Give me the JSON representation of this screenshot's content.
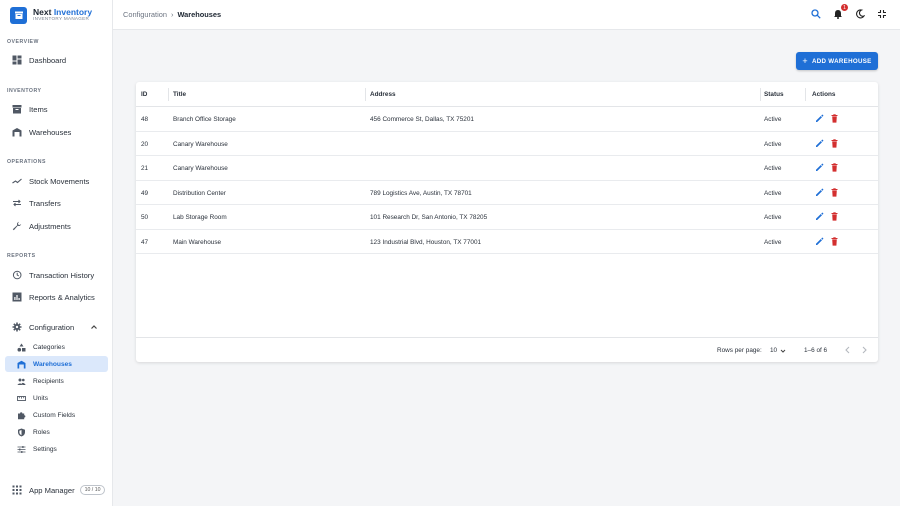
{
  "brand": {
    "name_part1": "Next",
    "name_part2": "Inventory",
    "subtitle": "INVENTORY MANAGER"
  },
  "sidebar": {
    "sections": {
      "overview": "OVERVIEW",
      "inventory": "INVENTORY",
      "operations": "OPERATIONS",
      "reports": "REPORTS"
    },
    "items": {
      "dashboard": "Dashboard",
      "items": "Items",
      "warehouses": "Warehouses",
      "stock_movements": "Stock Movements",
      "transfers": "Transfers",
      "adjustments": "Adjustments",
      "transaction_history": "Transaction History",
      "reports_analytics": "Reports & Analytics",
      "configuration": "Configuration"
    },
    "config_sub": {
      "categories": "Categories",
      "warehouses": "Warehouses",
      "recipients": "Recipients",
      "units": "Units",
      "custom_fields": "Custom Fields",
      "roles": "Roles",
      "settings": "Settings"
    },
    "app_manager": {
      "label": "App Manager",
      "badge": "10 / 10"
    }
  },
  "header": {
    "breadcrumb_parent": "Configuration",
    "breadcrumb_sep": "›",
    "breadcrumb_current": "Warehouses",
    "notification_count": "1"
  },
  "toolbar": {
    "add_label": "ADD WAREHOUSE",
    "add_icon": "+"
  },
  "table": {
    "columns": {
      "id": "ID",
      "title": "Title",
      "address": "Address",
      "status": "Status",
      "actions": "Actions"
    },
    "rows": [
      {
        "id": "48",
        "title": "Branch Office Storage",
        "address": "456 Commerce St, Dallas, TX 75201",
        "status": "Active"
      },
      {
        "id": "20",
        "title": "Canary Warehouse",
        "address": "",
        "status": "Active"
      },
      {
        "id": "21",
        "title": "Canary Warehouse",
        "address": "",
        "status": "Active"
      },
      {
        "id": "49",
        "title": "Distribution Center",
        "address": "789 Logistics Ave, Austin, TX 78701",
        "status": "Active"
      },
      {
        "id": "50",
        "title": "Lab Storage Room",
        "address": "101 Research Dr, San Antonio, TX 78205",
        "status": "Active"
      },
      {
        "id": "47",
        "title": "Main Warehouse",
        "address": "123 Industrial Blvd, Houston, TX 77001",
        "status": "Active"
      }
    ],
    "footer": {
      "rows_per_page_label": "Rows per page:",
      "rows_per_page_value": "10",
      "range": "1–6 of 6"
    }
  },
  "colors": {
    "primary": "#1f6fd6",
    "danger": "#d32f2f",
    "active_bg": "#dbe8fb"
  }
}
